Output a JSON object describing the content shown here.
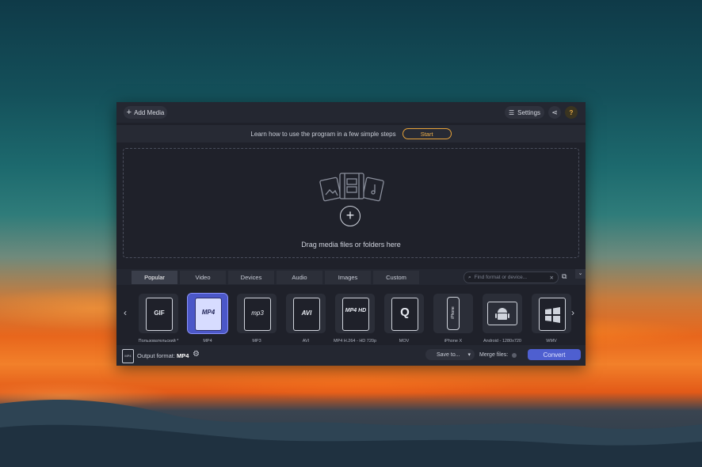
{
  "toolbar": {
    "add_media_label": "Add Media",
    "settings_label": "Settings"
  },
  "learn": {
    "text": "Learn how to use the program in a few simple steps",
    "start_label": "Start"
  },
  "drop": {
    "text": "Drag media files or folders here"
  },
  "tabs": [
    {
      "label": "Popular",
      "active": true
    },
    {
      "label": "Video"
    },
    {
      "label": "Devices"
    },
    {
      "label": "Audio"
    },
    {
      "label": "Images"
    },
    {
      "label": "Custom"
    }
  ],
  "search": {
    "placeholder": "Find format or device..."
  },
  "formats": [
    {
      "label": "Пользовательский *",
      "icon_text": "GIF",
      "icon": "gif-icon"
    },
    {
      "label": "MP4",
      "icon_text": "MP4",
      "icon": "mp4-icon",
      "selected": true
    },
    {
      "label": "MP3",
      "icon_text": "mp3",
      "icon": "mp3-icon"
    },
    {
      "label": "AVI",
      "icon_text": "AVI",
      "icon": "avi-icon"
    },
    {
      "label": "MP4 H.264 - HD 720p",
      "icon_text": "MP4 HD",
      "icon": "mp4-hd-icon"
    },
    {
      "label": "MOV",
      "icon_text": "Q",
      "icon": "quicktime-icon"
    },
    {
      "label": "iPhone X",
      "icon_text": "iPhone",
      "icon": "iphone-icon"
    },
    {
      "label": "Android - 1280x720",
      "icon_text": "",
      "icon": "android-icon"
    },
    {
      "label": "WMV",
      "icon_text": "",
      "icon": "windows-icon"
    }
  ],
  "bottom": {
    "output_label": "Output format:",
    "output_value": "MP4",
    "save_label": "Save to...",
    "merge_label": "Merge files:",
    "convert_label": "Convert"
  },
  "colors": {
    "accent": "#4e5fd0",
    "start_border": "#e8a33a",
    "selected_format": "#4b57c8"
  }
}
